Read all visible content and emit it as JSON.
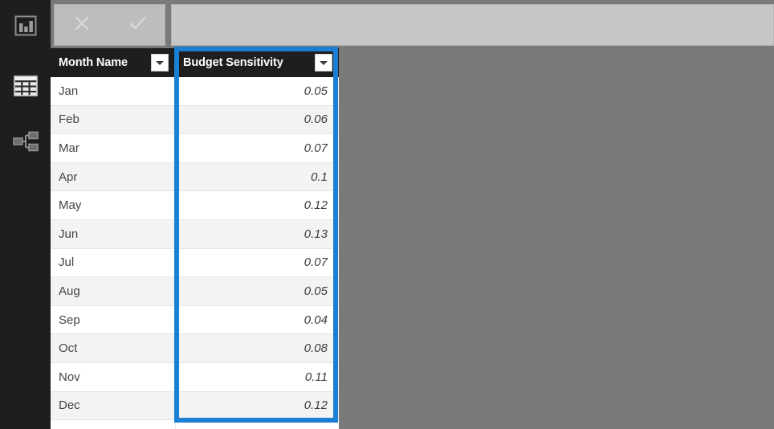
{
  "app": {
    "background_color": "#7a7a7a",
    "sidebar_color": "#1e1e1e",
    "accent_color": "#1b7fd4",
    "header_color": "#1e1e1e"
  },
  "sidebar": {
    "items": [
      {
        "id": "report",
        "icon": "bar-chart-icon",
        "label": "Report view",
        "active": false
      },
      {
        "id": "data",
        "icon": "table-grid-icon",
        "label": "Data view",
        "active": true
      },
      {
        "id": "model",
        "icon": "model-relationships-icon",
        "label": "Model view",
        "active": false
      }
    ]
  },
  "formula_bar": {
    "cancel_icon": "close-x-icon",
    "commit_icon": "check-icon",
    "input_value": "",
    "input_placeholder": ""
  },
  "grid": {
    "columns": [
      {
        "key": "month",
        "label": "Month Name",
        "align": "left",
        "filter_icon": "chevron-down-icon"
      },
      {
        "key": "value",
        "label": "Budget Sensitivity",
        "align": "right",
        "filter_icon": "chevron-down-icon"
      }
    ],
    "rows": [
      {
        "month": "Jan",
        "value": "0.05"
      },
      {
        "month": "Feb",
        "value": "0.06"
      },
      {
        "month": "Mar",
        "value": "0.07"
      },
      {
        "month": "Apr",
        "value": "0.1"
      },
      {
        "month": "May",
        "value": "0.12"
      },
      {
        "month": "Jun",
        "value": "0.13"
      },
      {
        "month": "Jul",
        "value": "0.07"
      },
      {
        "month": "Aug",
        "value": "0.05"
      },
      {
        "month": "Sep",
        "value": "0.04"
      },
      {
        "month": "Oct",
        "value": "0.08"
      },
      {
        "month": "Nov",
        "value": "0.11"
      },
      {
        "month": "Dec",
        "value": "0.12"
      }
    ]
  },
  "annotation": {
    "highlight_target": "Budget Sensitivity",
    "highlight_color": "#1b7fd4"
  }
}
